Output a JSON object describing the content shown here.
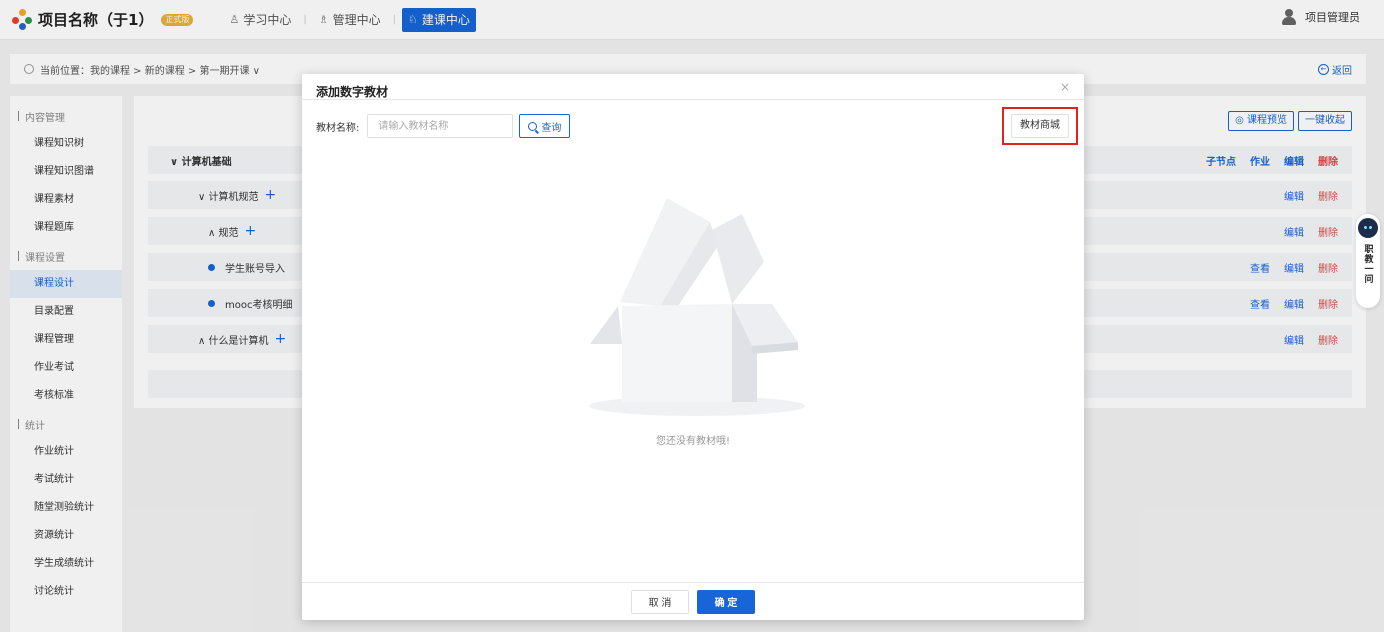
{
  "header": {
    "project_title": "项目名称（于1）",
    "badge": "正式版",
    "nav": [
      {
        "label": "学习中心",
        "icon": "learning-icon"
      },
      {
        "label": "管理中心",
        "icon": "manage-icon"
      },
      {
        "label": "建课中心",
        "icon": "build-course-icon"
      }
    ],
    "active_nav": "建课中心",
    "user_label": "项目管理员"
  },
  "breadcrumb": {
    "text": "当前位置：我的课程 > 新的课程 > 第一期开课 ∨",
    "back_label": "返回"
  },
  "sidebar": {
    "groups": [
      {
        "title": "内容管理",
        "items": [
          "课程知识树",
          "课程知识图谱",
          "课程素材",
          "课程题库"
        ]
      },
      {
        "title": "课程设置",
        "items": [
          "课程设计",
          "目录配置",
          "课程管理",
          "作业考试",
          "考核标准"
        ]
      },
      {
        "title": "统计",
        "items": [
          "作业统计",
          "考试统计",
          "随堂测验统计",
          "资源统计",
          "学生成绩统计",
          "讨论统计"
        ]
      }
    ],
    "active_item": "课程设计"
  },
  "main": {
    "preview_label": "课程预览",
    "collapse_label": "一键收起",
    "tree": [
      {
        "label": "∨ 计算机基础",
        "plus": "",
        "actions": [
          "子节点",
          "作业",
          "编辑",
          "删除"
        ]
      },
      {
        "label": "∨ 计算机规范",
        "plus": "+",
        "actions": [
          "编辑",
          "删除"
        ]
      },
      {
        "label": "∧ 规范",
        "plus": "+",
        "actions": [
          "编辑",
          "删除"
        ]
      },
      {
        "label": "学生账号导入",
        "plus": "",
        "actions": [
          "查看",
          "编辑",
          "删除"
        ]
      },
      {
        "label": "mooc考核明细",
        "plus": "",
        "actions": [
          "查看",
          "编辑",
          "删除"
        ]
      },
      {
        "label": "∧ 什么是计算机",
        "plus": "+",
        "actions": [
          "编辑",
          "删除"
        ]
      }
    ]
  },
  "ai_float": {
    "label": "职教一问"
  },
  "modal": {
    "title": "添加数字教材",
    "close_glyph": "×",
    "search_label": "教材名称:",
    "search_placeholder": "请输入教材名称",
    "search_button": "查询",
    "mall_button": "教材商城",
    "empty_text": "您还没有教材哦!",
    "cancel_label": "取 消",
    "ok_label": "确 定"
  },
  "colors": {
    "primary": "#1765d8",
    "danger": "#e04b4b",
    "highlight": "#e0241b"
  }
}
